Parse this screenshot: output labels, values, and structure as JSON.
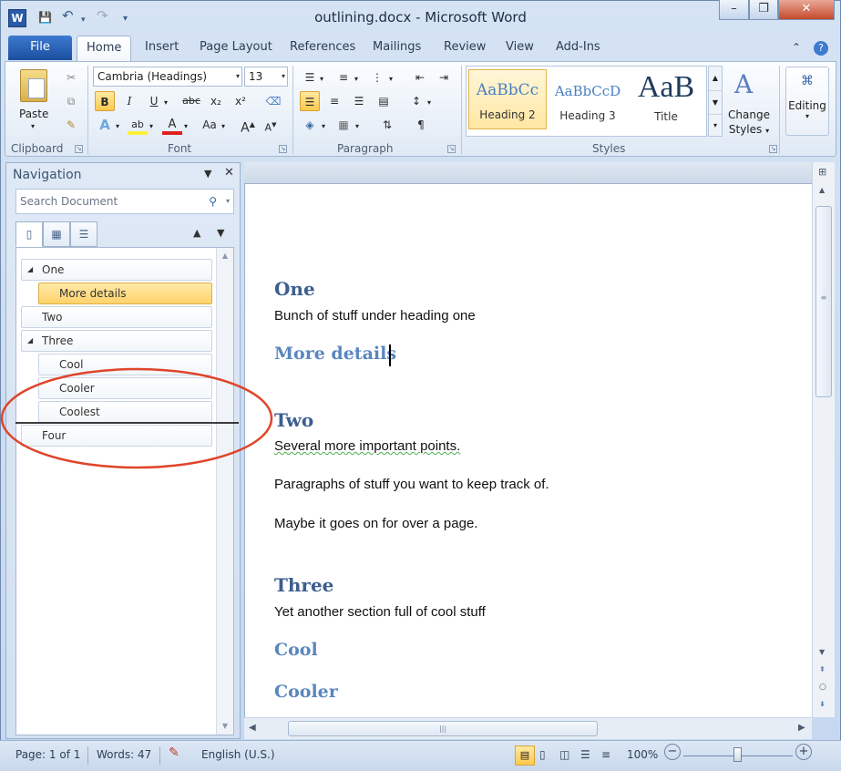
{
  "window": {
    "title": "outlining.docx - Microsoft Word",
    "app_icon": "W",
    "controls": {
      "minimize": "–",
      "restore": "❐",
      "close": "✕"
    }
  },
  "qat": {
    "save_icon": "💾",
    "undo_icon": "↶",
    "redo_icon": "↷",
    "customize_icon": "▾"
  },
  "tabs": {
    "file": "File",
    "items": [
      "Home",
      "Insert",
      "Page Layout",
      "References",
      "Mailings",
      "Review",
      "View",
      "Add-Ins"
    ],
    "active": "Home"
  },
  "ribbon": {
    "clipboard": {
      "paste": "Paste",
      "label": "Clipboard"
    },
    "font": {
      "family": "Cambria (Headings)",
      "size": "13",
      "label": "Font",
      "bold": "B",
      "italic": "I",
      "underline": "U",
      "strike": "abc",
      "sub": "x₂",
      "sup": "x²",
      "grow": "A",
      "shrink": "A",
      "case": "Aa",
      "clear": "A"
    },
    "paragraph": {
      "label": "Paragraph",
      "pilcrow": "¶"
    },
    "styles": {
      "label": "Styles",
      "tiles": [
        {
          "preview": "AaBbCc",
          "name": "Heading 2"
        },
        {
          "preview": "AaBbCcD",
          "name": "Heading 3"
        },
        {
          "preview": "AaB",
          "name": "Title"
        }
      ],
      "change_styles": "Change Styles",
      "change_styles_line1": "Change",
      "change_styles_line2": "Styles"
    },
    "editing": {
      "label": "Editing"
    }
  },
  "nav": {
    "title": "Navigation",
    "search_placeholder": "Search Document",
    "items": [
      {
        "label": "One",
        "level": 1,
        "expanded": true
      },
      {
        "label": "More details",
        "level": 2,
        "selected": true
      },
      {
        "label": "Two",
        "level": 1
      },
      {
        "label": "Three",
        "level": 1,
        "expanded": true
      },
      {
        "label": "Cool",
        "level": 2
      },
      {
        "label": "Cooler",
        "level": 2
      },
      {
        "label": "Coolest",
        "level": 2
      },
      {
        "label": "Four",
        "level": 1
      }
    ]
  },
  "document": {
    "h_one": "One",
    "p_one": "Bunch of stuff under heading one",
    "h_more": "More details",
    "h_two": "Two",
    "p_two_a": "Several more important points.",
    "p_two_b": "Paragraphs of stuff you want to keep track of.",
    "p_two_c": "Maybe it goes on for over a page.",
    "h_three": "Three",
    "p_three": "Yet another section full of cool stuff",
    "h_cool": "Cool",
    "h_cooler": "Cooler"
  },
  "status": {
    "page": "Page: 1 of 1",
    "words": "Words: 47",
    "language": "English (U.S.)",
    "zoom": "100%"
  },
  "colors": {
    "annotation_ellipse": "#e0442a",
    "heading1": "#3b5f8f",
    "heading2": "#5a86bf",
    "selected": "#ffd36b"
  }
}
